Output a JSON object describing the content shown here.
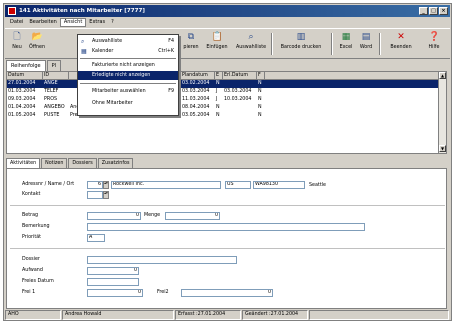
{
  "window": {
    "title": "141 Aktivitäten nach Mitarbeiter [7777]",
    "min": "_",
    "max": "□",
    "close": "×"
  },
  "menu": [
    "Datei",
    "Bearbeiten",
    "Ansicht",
    "Extras",
    "?"
  ],
  "toolbar": {
    "neu": "Neu",
    "oeffnen": "Öffnen",
    "kopieren": "pieren",
    "einfuegen": "Einfügen",
    "auswahlliste": "Auswahlliste",
    "barcode": "Barcode drucken",
    "excel": "Excel",
    "word": "Word",
    "beenden": "Beenden",
    "hilfe": "Hilfe"
  },
  "view_tabs": [
    "Reihenfolge",
    "Pl"
  ],
  "dropdown": {
    "items": [
      {
        "label": "Auswahlliste",
        "shortcut": "F4"
      },
      {
        "label": "Kalender",
        "shortcut": "Ctrl+K"
      },
      {
        "label": "Fakturierte nicht anzeigen",
        "shortcut": ""
      },
      {
        "label": "Erledigte nicht anzeigen",
        "shortcut": ""
      },
      {
        "label": "Mitarbeiter auswählen",
        "shortcut": "F9"
      },
      {
        "label": "Ohne Mitarbeiter",
        "shortcut": ""
      }
    ]
  },
  "grid": {
    "headers": [
      "Datum",
      "ID",
      "",
      "name",
      "Plandatum",
      "E",
      "Erl.Datum",
      "F"
    ],
    "rows": [
      [
        "27.01.2004",
        "ANGE",
        "",
        "KWELL",
        "03.02.2004",
        "N",
        "",
        "N"
      ],
      [
        "01.03.2004",
        "TELEF",
        "",
        "LINGS AG",
        "03.03.2004",
        "J",
        "03.03.2004",
        "N"
      ],
      [
        "09.03.2004",
        "PROS",
        "",
        "LINGS AG",
        "11.03.2004",
        "J",
        "10.03.2004",
        "N"
      ],
      [
        "01.04.2004",
        "ANGEBO",
        "Angebot erarbeiten",
        "RILLINGS AG",
        "08.04.2004",
        "N",
        "",
        "N"
      ],
      [
        "01.05.2004",
        "PUSTE",
        "Preisliste",
        "RILLINGS AG",
        "03.05.2004",
        "N",
        "",
        "N"
      ]
    ]
  },
  "subtabs": [
    "Aktivitäten",
    "Notizen",
    "Dossiers",
    "Zusatzinfos"
  ],
  "form": {
    "adressnr_label": "Adressnr / Name / Ort",
    "adressnr": "6",
    "name": "Rockwell Inc.",
    "land": "US",
    "plz": "WA98130",
    "ort": "Seattle",
    "kontakt_label": "Kontakt",
    "betrag_label": "Betrag",
    "betrag": "0",
    "menge_label": "Menge",
    "menge": "0",
    "bemerkung_label": "Bemerkung",
    "prioritaet_label": "Priorität",
    "prioritaet": "A",
    "dossier_label": "Dossier",
    "aufwand_label": "Aufwand",
    "aufwand": "0",
    "freies_datum_label": "Freies Datum",
    "frei1_label": "Frei 1",
    "frei1": "0",
    "frei2_label": "Frei2",
    "frei2": "0"
  },
  "status": [
    "AHO",
    "Andrea Howald",
    "Erfasst :27.01.2004",
    "Geändert :27.01.2004"
  ]
}
